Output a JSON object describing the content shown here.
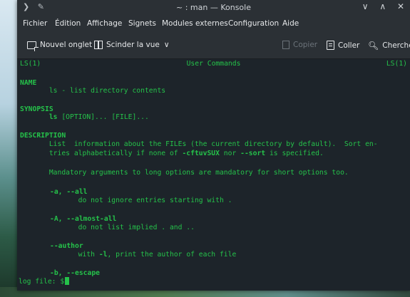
{
  "window": {
    "title": "~ : man — Konsole",
    "left_controls": [
      "❯",
      "✎"
    ],
    "right_controls": [
      "∨",
      "∧",
      "✕"
    ]
  },
  "menubar": {
    "items": [
      "Fichier",
      "Édition",
      "Affichage",
      "Signets",
      "Modules externes",
      "Configuration",
      "Aide"
    ]
  },
  "toolbar": {
    "new_tab": "Nouvel onglet",
    "split_view": "Scinder la vue",
    "copy": "Copier",
    "paste": "Coller",
    "search": "Chercher",
    "chevron": "∨"
  },
  "terminal": {
    "header_left": "LS(1)",
    "header_center": "User Commands",
    "header_right": "LS(1)",
    "name_heading": "NAME",
    "name_text": "       ls - list directory contents",
    "synopsis_heading": "SYNOPSIS",
    "synopsis_cmd": "ls",
    "synopsis_args": " [OPTION]... [FILE]...",
    "description_heading": "DESCRIPTION",
    "desc_line1": "       List  information about the FILEs (the current directory by default).  Sort en-",
    "desc_line2_a": "       tries alphabetically if none of ",
    "desc_line2_b": "-cftuvSUX",
    "desc_line2_c": " nor ",
    "desc_line2_d": "--sort",
    "desc_line2_e": " is specified.",
    "mandatory": "       Mandatory arguments to long options are mandatory for short options too.",
    "opt_a": "-a, --all",
    "opt_a_desc": "              do not ignore entries starting with .",
    "opt_A": "-A, --almost-all",
    "opt_A_desc": "              do not list implied . and ..",
    "opt_author": "--author",
    "opt_author_desc_a": "              with ",
    "opt_author_desc_b": "-l",
    "opt_author_desc_c": ", print the author of each file",
    "opt_b": "-b, --escape",
    "prompt": "log file: $"
  }
}
